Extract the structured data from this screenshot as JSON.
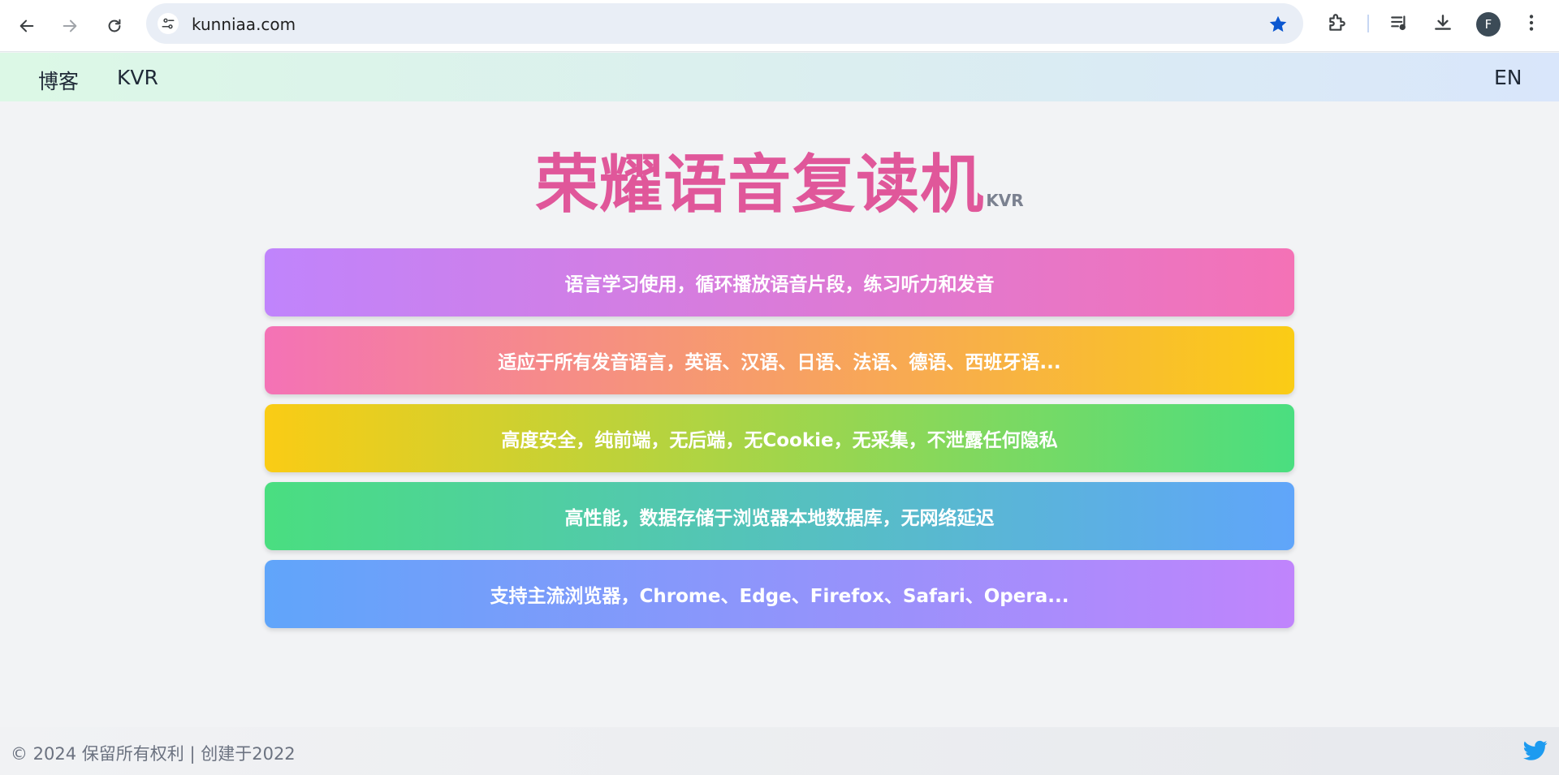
{
  "browser": {
    "url": "kunniaa.com",
    "profile_initial": "F",
    "icons": [
      "back-icon",
      "forward-icon",
      "reload-icon",
      "site-settings-icon",
      "bookmark-star-icon",
      "extensions-icon",
      "media-control-icon",
      "download-icon",
      "more-icon"
    ],
    "star_color": "#0b57d0"
  },
  "header": {
    "nav": [
      "博客",
      "KVR"
    ],
    "lang": "EN"
  },
  "hero": {
    "title": "荣耀语音复读机",
    "sub": "KVR",
    "title_color": "#e0579a"
  },
  "features": [
    "语言学习使用，循环播放语音片段，练习听力和发音",
    "适应于所有发音语言，英语、汉语、日语、法语、德语、西班牙语...",
    "高度安全，纯前端，无后端，无Cookie，无采集，不泄露任何隐私",
    "高性能，数据存储于浏览器本地数据库，无网络延迟",
    "支持主流浏览器，Chrome、Edge、Firefox、Safari、Opera..."
  ],
  "footer": {
    "copyright": "© 2024 保留所有权利 | 创建于2022",
    "social_icon": "twitter-icon",
    "twitter_color": "#1d9bf0"
  }
}
